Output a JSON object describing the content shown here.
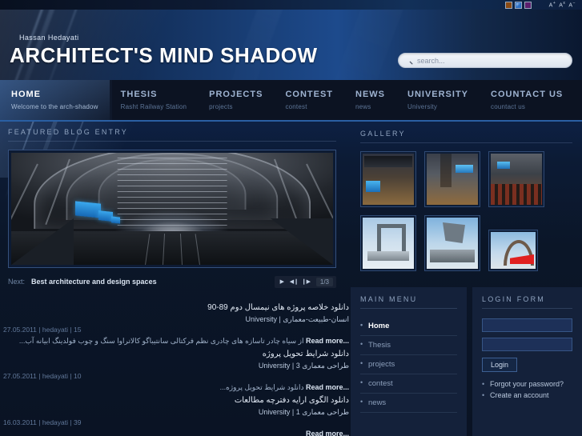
{
  "topbar": {
    "swatches": [
      {
        "name": "brown-theme",
        "color": "#8a4a14"
      },
      {
        "name": "blue-theme",
        "color": "#2d6fc4"
      },
      {
        "name": "purple-theme",
        "color": "#5b1f6e"
      }
    ],
    "font_increase": "A",
    "font_increase_sup": "+",
    "font_reset": "A",
    "font_reset_sup": "x",
    "font_decrease": "A",
    "font_decrease_sup": "−"
  },
  "header": {
    "byline": "Hassan Hedayati",
    "title": "ARCHITECT'S MIND SHADOW",
    "search_placeholder": "search...",
    "search_value": ""
  },
  "nav": {
    "items": [
      {
        "label": "HOME",
        "sub": "Welcome to the arch-shadow",
        "active": true
      },
      {
        "label": "THESIS",
        "sub": "Rasht Railway Station",
        "active": false
      },
      {
        "label": "PROJECTS",
        "sub": "projects",
        "active": false
      },
      {
        "label": "CONTEST",
        "sub": "contest",
        "active": false
      },
      {
        "label": "NEWS",
        "sub": "news",
        "active": false
      },
      {
        "label": "UNIVERSITY",
        "sub": "University",
        "active": false
      },
      {
        "label": "COUNTACT US",
        "sub": "countact us",
        "active": false
      }
    ]
  },
  "featured": {
    "section_title": "FEATURED BLOG ENTRY",
    "next_label": "Next:",
    "next_title": "Best architecture and design spaces",
    "controls": {
      "play": "▶",
      "prev": "◀❙",
      "next": "❙▶"
    },
    "counter": "1/3"
  },
  "gallery": {
    "section_title": "GALLERY",
    "items": [
      {
        "name": "gallery-thumb-1",
        "alt": "Railway station interior with signage"
      },
      {
        "name": "gallery-thumb-2",
        "alt": "Station concourse with escalators"
      },
      {
        "name": "gallery-thumb-3",
        "alt": "Vaulted hall with red seating"
      },
      {
        "name": "gallery-thumb-4",
        "alt": "Architectural model white base"
      },
      {
        "name": "gallery-thumb-5",
        "alt": "Concrete tower structure model"
      },
      {
        "name": "gallery-thumb-6",
        "alt": "Arched canopy with red roof"
      }
    ]
  },
  "articles": [
    {
      "title": "دانلود خلاصه پروژه های نیمسال دوم 89-90",
      "category_fa": "انسان-طبیعت-معماری",
      "category_en": "University",
      "date": "27.05.2011",
      "author": "hedayati",
      "hits": "15",
      "excerpt": "از سیاه چادر تاسازه های چادری نظم فرکتالی سانتیباگو کالاتراوا سنگ و چوب فولدینگ ابیانه آب...",
      "read_more": "Read more..."
    },
    {
      "title": "دانلود شرایط تحویل پروژه",
      "category_fa": "طراحی معماری 3",
      "category_en": "University",
      "date": "27.05.2011",
      "author": "hedayati",
      "hits": "10",
      "excerpt": "دانلود شرایط تحویل پروژه...",
      "read_more": "Read more..."
    },
    {
      "title": "دانلود الگوی ارایه دفترچه مطالعات",
      "category_fa": "طراحی معماری 1",
      "category_en": "University",
      "date": "16.03.2011",
      "author": "hedayati",
      "hits": "39",
      "excerpt": "",
      "read_more": "Read more..."
    }
  ],
  "main_menu": {
    "title": "MAIN MENU",
    "items": [
      {
        "label": "Home",
        "active": true
      },
      {
        "label": "Thesis",
        "active": false
      },
      {
        "label": "projects",
        "active": false
      },
      {
        "label": "contest",
        "active": false
      },
      {
        "label": "news",
        "active": false
      }
    ]
  },
  "login_form": {
    "title": "LOGIN FORM",
    "username_value": "",
    "password_value": "",
    "button_label": "Login",
    "links": [
      "Forgot your password?",
      "Create an account"
    ]
  }
}
